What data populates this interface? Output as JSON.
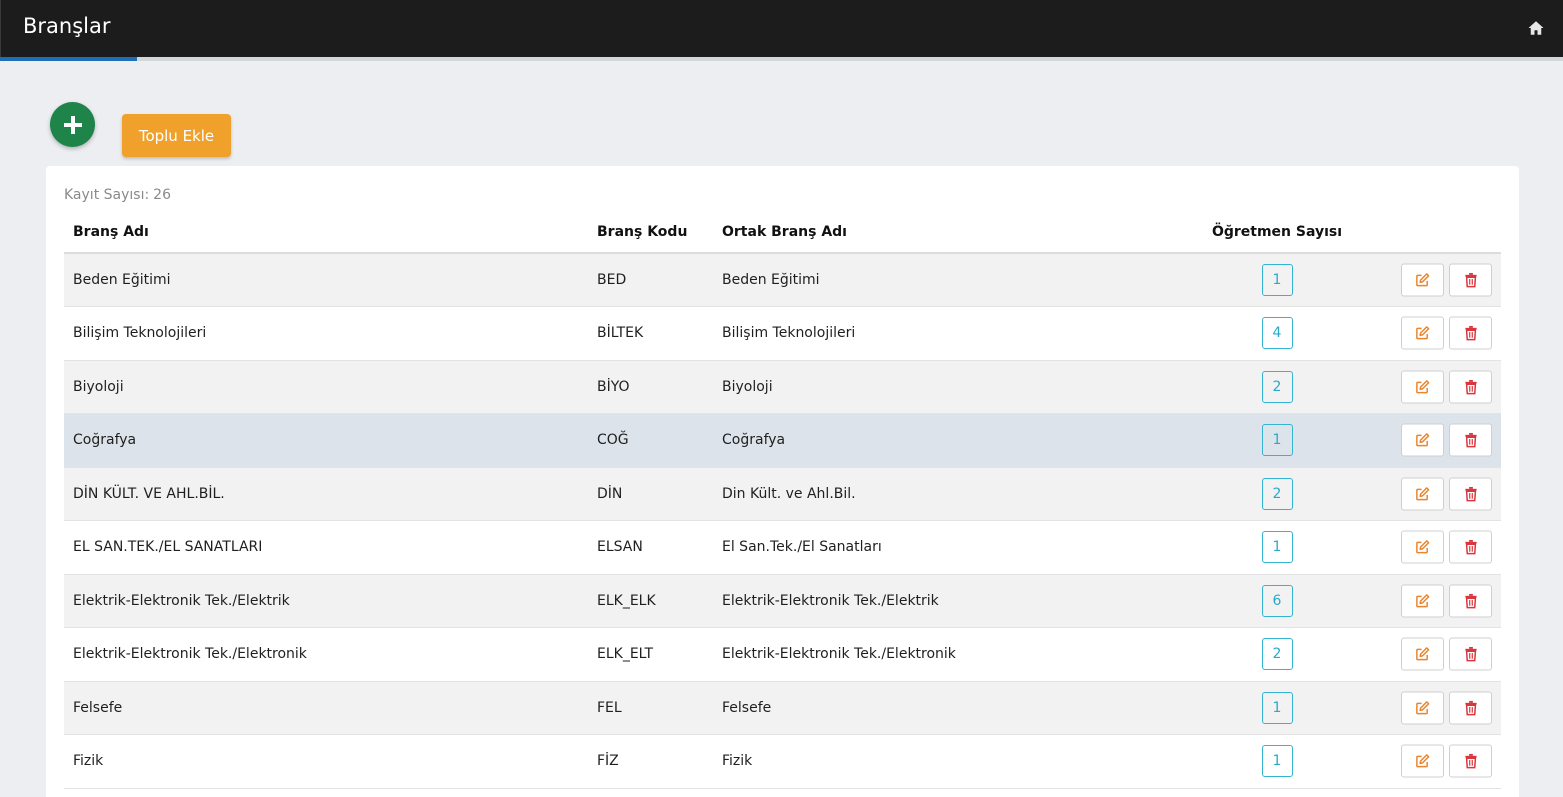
{
  "header": {
    "title": "Branşlar",
    "home_icon": "home-icon"
  },
  "toolbar": {
    "add_icon": "plus-icon",
    "bulk_add_label": "Toplu Ekle"
  },
  "records": {
    "label": "Kayıt Sayısı:",
    "count": "26"
  },
  "table": {
    "columns": {
      "name": "Branş Adı",
      "code": "Branş Kodu",
      "common": "Ortak Branş Adı",
      "teachers": "Öğretmen Sayısı"
    },
    "rows": [
      {
        "name": "Beden Eğitimi",
        "code": "BED",
        "common": "Beden Eğitimi",
        "teachers": "1"
      },
      {
        "name": "Bilişim Teknolojileri",
        "code": "BİLTEK",
        "common": "Bilişim Teknolojileri",
        "teachers": "4"
      },
      {
        "name": "Biyoloji",
        "code": "BİYO",
        "common": "Biyoloji",
        "teachers": "2"
      },
      {
        "name": "Coğrafya",
        "code": "COĞ",
        "common": "Coğrafya",
        "teachers": "1"
      },
      {
        "name": "DİN KÜLT. VE AHL.BİL.",
        "code": "DİN",
        "common": "Din Kült. ve Ahl.Bil.",
        "teachers": "2"
      },
      {
        "name": "EL SAN.TEK./EL SANATLARI",
        "code": "ELSAN",
        "common": "El San.Tek./El Sanatları",
        "teachers": "1"
      },
      {
        "name": "Elektrik-Elektronik Tek./Elektrik",
        "code": "ELK_ELK",
        "common": "Elektrik-Elektronik Tek./Elektrik",
        "teachers": "6"
      },
      {
        "name": "Elektrik-Elektronik Tek./Elektronik",
        "code": "ELK_ELT",
        "common": "Elektrik-Elektronik Tek./Elektronik",
        "teachers": "2"
      },
      {
        "name": "Felsefe",
        "code": "FEL",
        "common": "Felsefe",
        "teachers": "1"
      },
      {
        "name": "Fizik",
        "code": "FİZ",
        "common": "Fizik",
        "teachers": "1"
      }
    ]
  },
  "colors": {
    "header_bg": "#1c1c1c",
    "accent_blue": "#1e6fb6",
    "add_green": "#1e8449",
    "bulk_orange": "#f0a12b",
    "badge_cyan": "#2aa9c9",
    "edit_orange": "#e8862e",
    "delete_red": "#d9363e",
    "highlight_row": "#dde3ea"
  }
}
